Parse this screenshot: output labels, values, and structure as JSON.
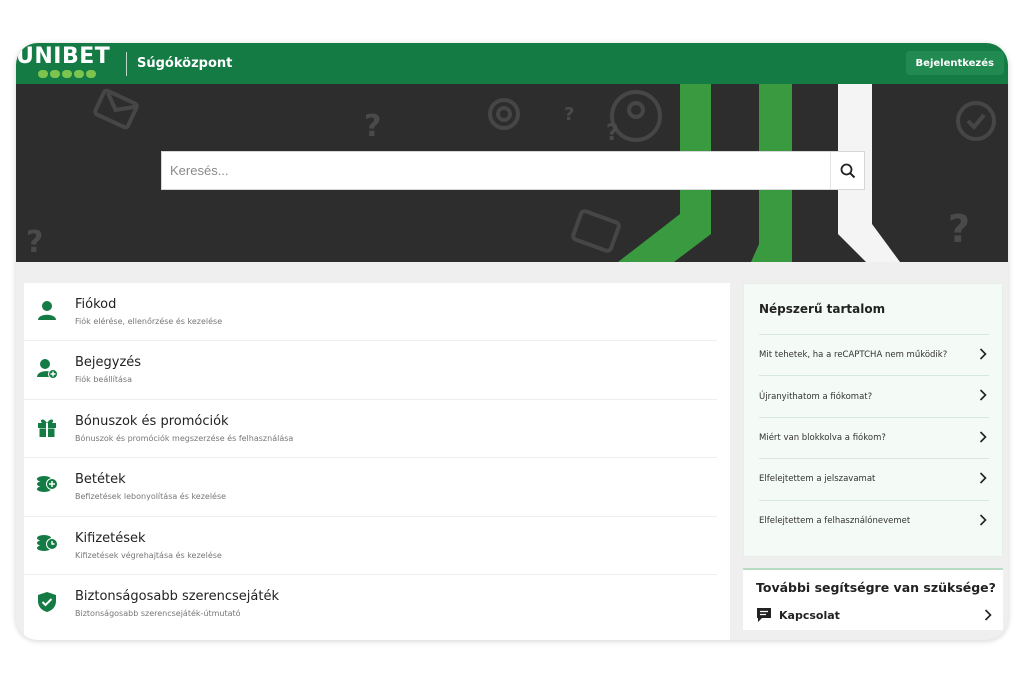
{
  "header": {
    "logo_text": "UNIBET",
    "title": "Súgóközpont",
    "login_label": "Bejelentkezés"
  },
  "search": {
    "placeholder": "Keresés...",
    "icon": "search-icon"
  },
  "categories": [
    {
      "title": "Fiókod",
      "description": "Fiók elérése, ellenőrzése és kezelése",
      "icon": "user-icon"
    },
    {
      "title": "Bejegyzés",
      "description": "Fiók beállítása",
      "icon": "user-add-icon"
    },
    {
      "title": "Bónuszok és promóciók",
      "description": "Bónuszok és promóciók megszerzése és felhasználása",
      "icon": "gift-icon"
    },
    {
      "title": "Betétek",
      "description": "Befizetések lebonyolítása és kezelése",
      "icon": "coins-plus-icon"
    },
    {
      "title": "Kifizetések",
      "description": "Kifizetések végrehajtása és kezelése",
      "icon": "coins-clock-icon"
    },
    {
      "title": "Biztonságosabb szerencsejáték",
      "description": "Biztonságosabb szerencsejáték-útmutató",
      "icon": "shield-check-icon"
    }
  ],
  "popular": {
    "title": "Népszerű tartalom",
    "items": [
      "Mit tehetek, ha a reCAPTCHA nem működik?",
      "Újranyithatom a fiókomat?",
      "Miért van blokkolva a fiókom?",
      "Elfelejtettem a jelszavamat",
      "Elfelejtettem a felhasználónevemet"
    ]
  },
  "help": {
    "title": "További segítségre van szüksége?",
    "contact_label": "Kapcsolat"
  },
  "colors": {
    "brand_green": "#147b45",
    "accent_green": "#3a9a3f",
    "hero_bg": "#2d2d2d"
  }
}
